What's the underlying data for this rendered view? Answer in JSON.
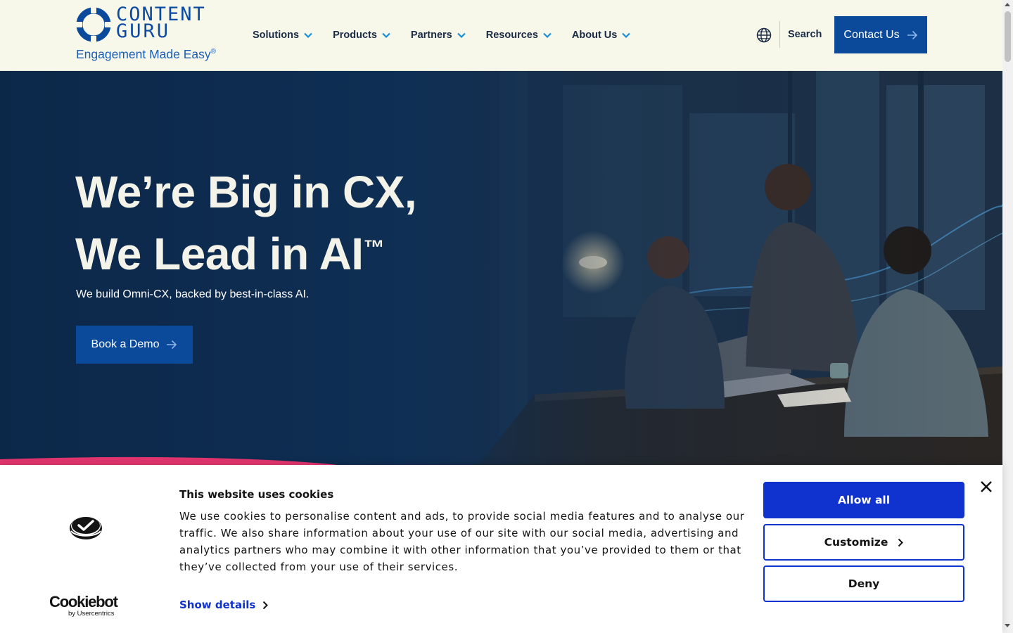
{
  "header": {
    "logo": {
      "word_line1": "CONTENT",
      "word_line2": "GURU",
      "tagline": "Engagement Made Easy",
      "tagline_mark": "®"
    },
    "nav": [
      {
        "label": "Solutions",
        "icon": "chevron-down-icon"
      },
      {
        "label": "Products",
        "icon": "chevron-down-icon"
      },
      {
        "label": "Partners",
        "icon": "chevron-down-icon"
      },
      {
        "label": "Resources",
        "icon": "chevron-down-icon"
      },
      {
        "label": "About Us",
        "icon": "chevron-down-icon"
      }
    ],
    "globe_icon": "globe-icon",
    "search_label": "Search",
    "contact_label": "Contact Us"
  },
  "hero": {
    "title_line1": "We’re Big in CX,",
    "title_line2": "We Lead in AI",
    "title_mark": "™",
    "subtitle": "We build Omni-CX, backed by best-in-class AI.",
    "cta_label": "Book a Demo"
  },
  "cookie_banner": {
    "title": "This website uses cookies",
    "body": "We use cookies to personalise content and ads, to provide social media features and to analyse our traffic. We also share information about your use of our site with our social media, advertising and analytics partners who may combine it with other information that you’ve provided to them or that they’ve collected from your use of their services.",
    "show_details_label": "Show details",
    "allow_all_label": "Allow all",
    "customize_label": "Customize",
    "deny_label": "Deny",
    "brand_name": "Cookiebot",
    "brand_by": "by Usercentrics"
  },
  "colors": {
    "header_bg": "#f7f7ea",
    "brand_blue": "#0b4a9a",
    "hero_navy": "#0c2849",
    "cookie_blue": "#1032cf",
    "accent_pink": "#e4356f"
  }
}
